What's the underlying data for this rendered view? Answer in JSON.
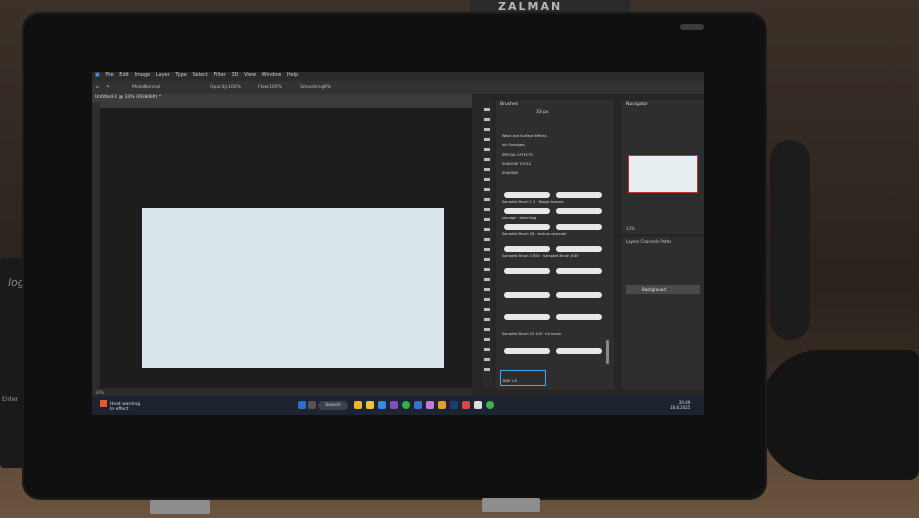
{
  "background": {
    "box_label": "ZALMAN",
    "keyboard_logo": "logi",
    "keyboard_key": "Enter"
  },
  "app": {
    "menu": [
      "File",
      "Edit",
      "Image",
      "Layer",
      "Type",
      "Select",
      "Filter",
      "3D",
      "View",
      "Window",
      "Help"
    ],
    "options": {
      "mode_label": "Mode:",
      "mode_value": "Normal",
      "opacity_label": "Opacity:",
      "opacity_value": "100%",
      "flow_label": "Flow:",
      "flow_value": "100%",
      "smoothing_label": "Smoothing:",
      "smoothing_value": "0%"
    },
    "doc_tab": "Untitled-1 @ 33% (RGB/8#) *",
    "status_zoom": "33%",
    "brushes_panel": {
      "title": "Brushes",
      "size": "33 px",
      "groups": [
        "Wash and Surface Effects",
        "Ink Smudges",
        "SPECIAL EFFECTS",
        "SHADOW TOOLS",
        "SHADING"
      ],
      "brushes": [
        "Sampled Brush 1 2",
        "Rough texture",
        "smudge",
        "sketching",
        "Sampled Brush 28",
        "texture charcoal",
        "Sampled Brush 3 850",
        "Sampled Brush 8 85",
        "Sampled Brush 20 100",
        "fur brush"
      ],
      "selected": "BSB 1 B"
    },
    "navigator": {
      "title": "Navigator",
      "zoom": "33%"
    },
    "layers": {
      "tabs": [
        "Layers",
        "Channels",
        "Paths"
      ],
      "layer_name": "Background"
    },
    "taskbar": {
      "search": "Search",
      "time": "20:49",
      "date": "18.8.2025"
    },
    "notification": {
      "line1": "Heat warning",
      "line2": "In effect"
    }
  }
}
